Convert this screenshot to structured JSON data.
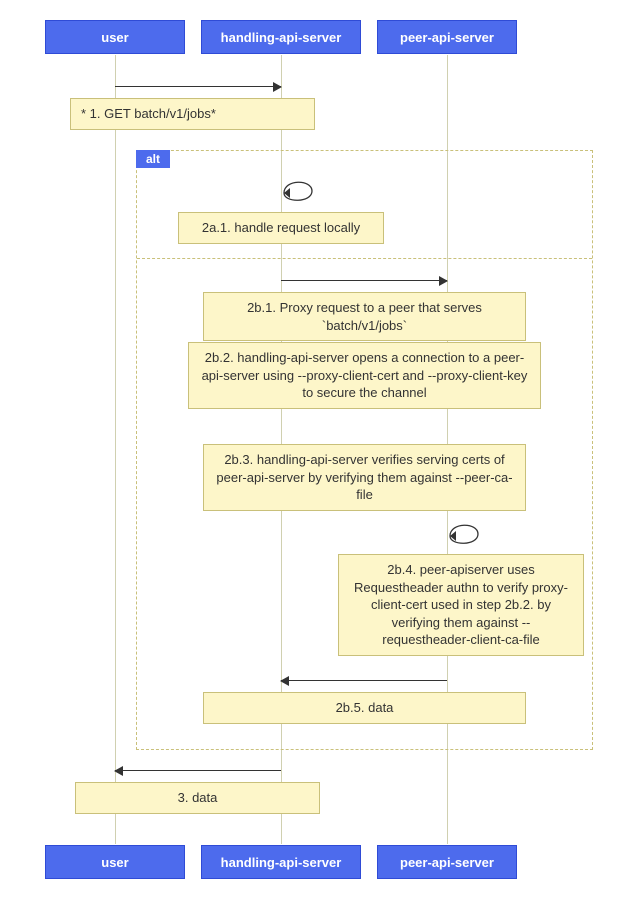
{
  "diagram_type": "sequence",
  "actors": {
    "user": "user",
    "handling": "handling-api-server",
    "peer": "peer-api-server"
  },
  "alt_label": "alt",
  "messages": {
    "step1": "* 1. GET batch/v1/jobs*",
    "step2a1": "2a.1. handle request locally",
    "step2b1": "2b.1. Proxy request to a peer that serves `batch/v1/jobs`",
    "step2b2": "2b.2. handling-api-server opens a connection to a peer-api-server using --proxy-client-cert and --proxy-client-key to secure the channel",
    "step2b3": "2b.3. handling-api-server verifies serving certs of peer-api-server by verifying them against --peer-ca-file",
    "step2b4": "2b.4. peer-apiserver uses Requestheader authn to verify proxy-client-cert used in step 2b.2. by verifying them against --requestheader-client-ca-file",
    "step2b5": "2b.5. data",
    "step3": "3. data"
  }
}
